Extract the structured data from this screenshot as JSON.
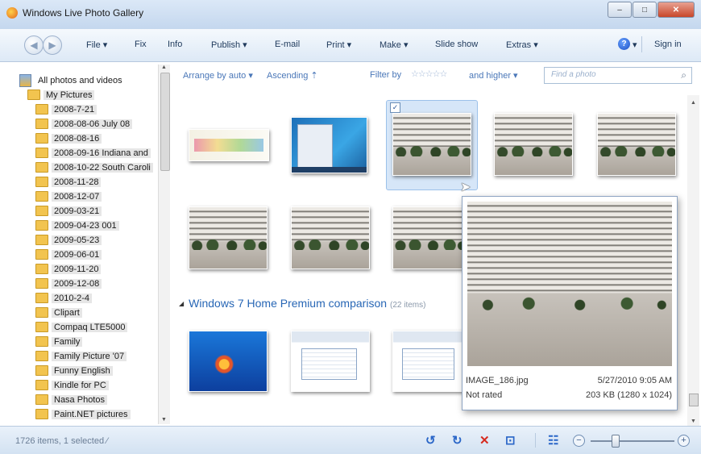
{
  "window": {
    "title": "Windows Live Photo Gallery",
    "controls": {
      "minimize": "–",
      "maximize": "□",
      "close": "✕"
    }
  },
  "menu": {
    "back_glyph": "◀",
    "forward_glyph": "▶",
    "items": [
      "File ▾",
      "Fix",
      "Info",
      "Publish ▾",
      "E-mail",
      "Print ▾",
      "Make ▾",
      "Slide show",
      "Extras ▾"
    ],
    "help_glyph": "?",
    "help_dropdown": "▾",
    "sign_in": "Sign in"
  },
  "sidebar": {
    "root": "All photos and videos",
    "parent": "My Pictures",
    "folders": [
      "2008-7-21",
      "2008-08-06 July 08",
      "2008-08-16",
      "2008-09-16 Indiana and",
      "2008-10-22 South Caroli",
      "2008-11-28",
      "2008-12-07",
      "2009-03-21",
      "2009-04-23 001",
      "2009-05-23",
      "2009-06-01",
      "2009-11-20",
      "2009-12-08",
      "2010-2-4",
      "Clipart",
      "Compaq LTE5000",
      "Family",
      "Family Picture '07",
      "Funny English",
      "Kindle for PC",
      "Nasa Photos",
      "Paint.NET pictures"
    ]
  },
  "toolbar": {
    "arrange": "Arrange by auto ▾",
    "order": "Ascending ⇡",
    "filter": "Filter by",
    "stars": "☆☆☆☆☆",
    "filter_suffix": "and higher ▾",
    "search_placeholder": "Find a photo",
    "search_glyph": "⌕"
  },
  "gallery": {
    "selected_check": "✓",
    "group_title": "Windows 7 Home Premium comparison",
    "group_count": "(22 items)"
  },
  "preview": {
    "filename": "IMAGE_186.jpg",
    "datetime": "5/27/2010 9:05 AM",
    "rating": "Not rated",
    "size": "203 KB (1280 x 1024)"
  },
  "status": {
    "summary": "1726 items, 1 selected ⁄",
    "rotate_left": "↺",
    "rotate_right": "↻",
    "delete": "✕",
    "slideshow": "⊡",
    "details": "☷",
    "zoom_out": "−",
    "zoom_in": "+"
  },
  "colors": {
    "accent": "#2766b5",
    "delete": "#d62b1f",
    "action": "#2a66c8"
  }
}
